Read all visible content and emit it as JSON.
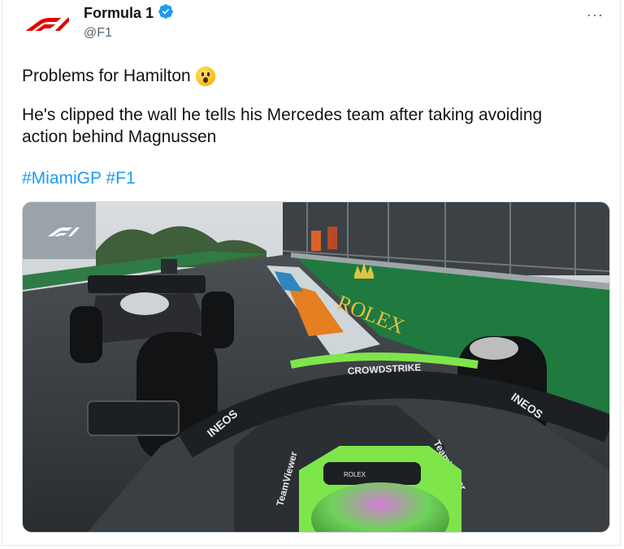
{
  "tweet": {
    "author": {
      "name": "Formula 1",
      "handle": "@F1",
      "verified": true
    },
    "more_label": "···",
    "text": {
      "line1": "Problems for Hamilton",
      "emoji": "astonished-face",
      "line2": "He's clipped the wall he tells his Mercedes team after taking avoiding action behind Magnussen",
      "hashtags": [
        "#MiamiGP",
        "#F1"
      ]
    }
  },
  "media": {
    "overlay_logo": "F1",
    "sponsor_texts": [
      "ROLEX",
      "CROWDSTRIKE",
      "INEOS",
      "INEOS",
      "TeamViewer",
      "TeamViewer",
      "ROLEX"
    ]
  },
  "colors": {
    "brand_red": "#e10600",
    "link_blue": "#1d9bf0",
    "verified_blue": "#1d9bf0",
    "wall_green": "#1f7a3f",
    "halo_green": "#7ee64a"
  }
}
